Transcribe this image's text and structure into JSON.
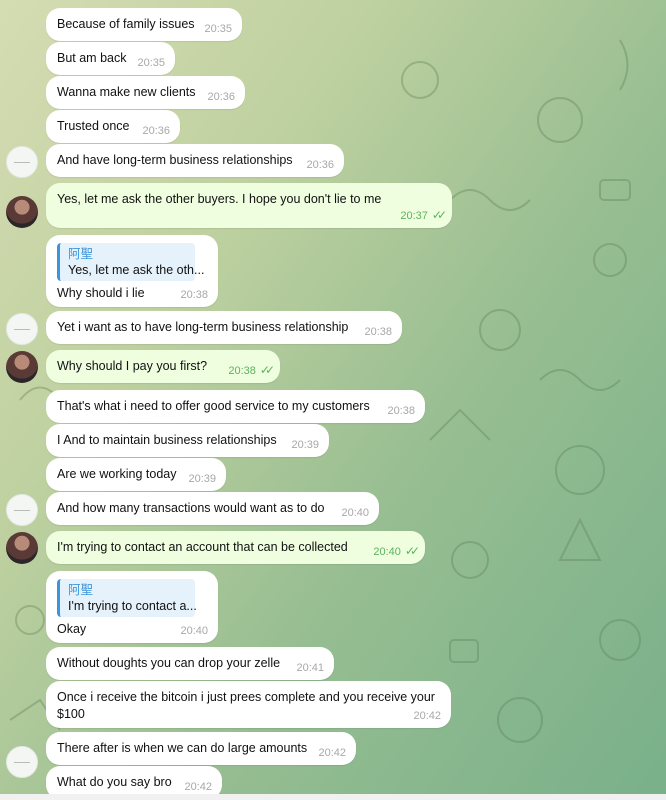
{
  "messages": [
    {
      "text": "Because of family issues",
      "time": "20:35"
    },
    {
      "text": "But am back",
      "time": "20:35"
    },
    {
      "text": "Wanna make new clients",
      "time": "20:36"
    },
    {
      "text": "Trusted once",
      "time": "20:36"
    },
    {
      "text": "And have long-term business relationships",
      "time": "20:36"
    },
    {
      "text": "Yes, let me ask the other buyers. I hope you don't lie to me",
      "time": "20:37"
    },
    {
      "reply_name": "阿聖",
      "reply_text": "Yes, let me ask the oth...",
      "text": "Why should i lie",
      "time": "20:38"
    },
    {
      "text": "Yet i want as to have long-term business relationship",
      "time": "20:38"
    },
    {
      "text": "Why should I pay you first?",
      "time": "20:38"
    },
    {
      "text": "That's what i need to offer good service to my customers",
      "time": "20:38"
    },
    {
      "text": "I And to maintain business relationships",
      "time": "20:39"
    },
    {
      "text": "Are we working today",
      "time": "20:39"
    },
    {
      "text": "And how many transactions would want as to do",
      "time": "20:40"
    },
    {
      "text": "I'm trying to contact an account that can be collected",
      "time": "20:40"
    },
    {
      "reply_name": "阿聖",
      "reply_text": "I'm trying to contact a...",
      "text": "Okay",
      "time": "20:40"
    },
    {
      "text": "Without doughts you can drop your zelle",
      "time": "20:41"
    },
    {
      "text": "Once i receive the bitcoin i just prees complete and you receive your $100",
      "time": "20:42"
    },
    {
      "text": "There after is when we can do large amounts",
      "time": "20:42"
    },
    {
      "text": "What do you say bro",
      "time": "20:42"
    }
  ],
  "read_receipt": "✓✓",
  "colors": {
    "incoming": "#ffffff",
    "outgoing": "#eefedf",
    "accent": "#3b95dc",
    "check": "#5fb25d"
  }
}
